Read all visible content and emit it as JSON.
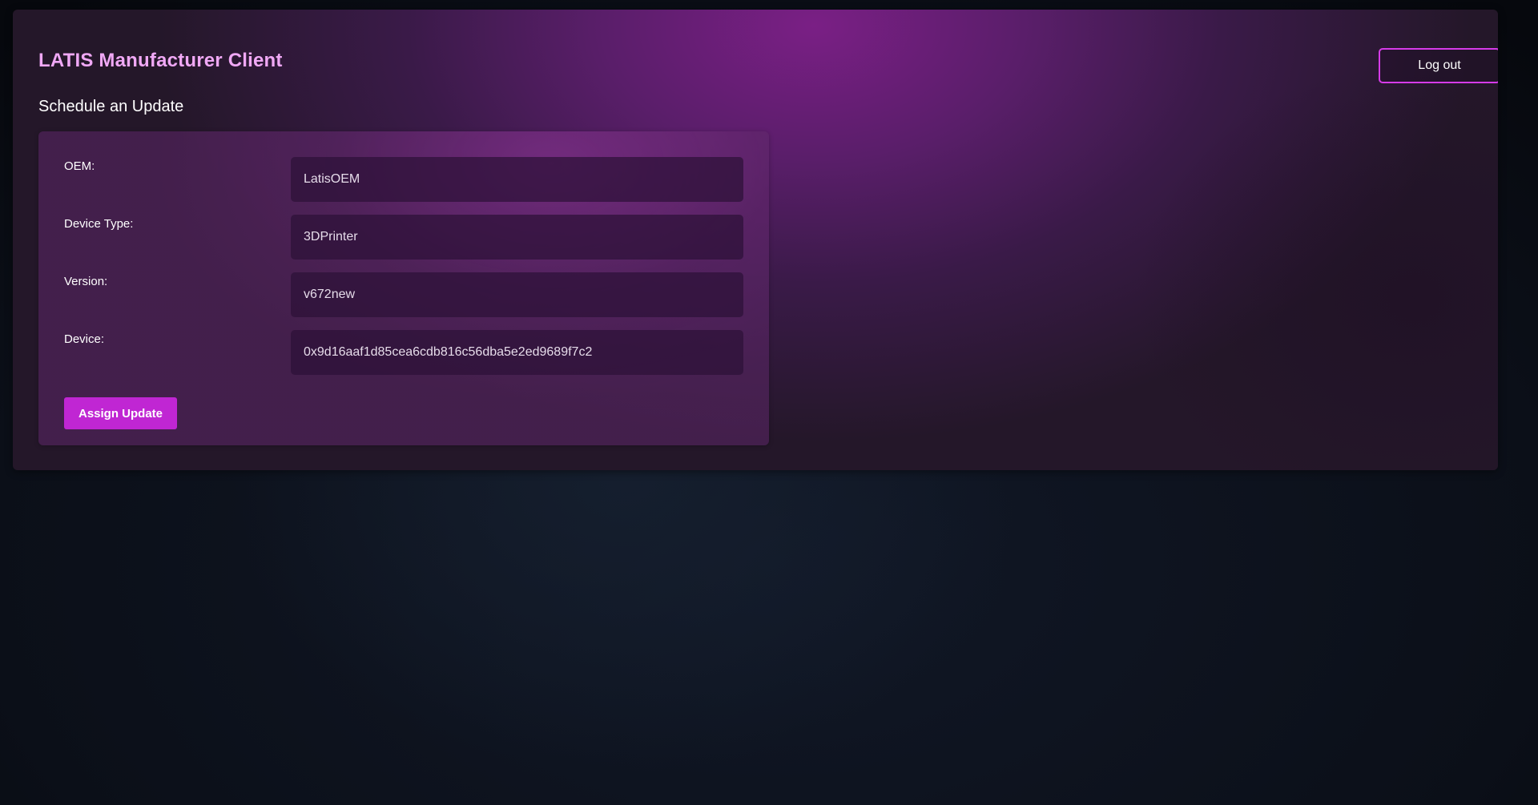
{
  "header": {
    "app_title": "LATIS Manufacturer Client",
    "logout_label": "Log out"
  },
  "page": {
    "section_title": "Schedule an Update"
  },
  "form": {
    "fields": [
      {
        "label": "OEM:",
        "value": "LatisOEM"
      },
      {
        "label": "Device Type:",
        "value": "3DPrinter"
      },
      {
        "label": "Version:",
        "value": "v672new"
      },
      {
        "label": "Device:",
        "value": "0x9d16aaf1d85cea6cdb816c56dba5e2ed9689f7c2"
      }
    ],
    "submit_label": "Assign Update"
  },
  "colors": {
    "title_accent": "#f0a8f5",
    "button_primary": "#c026d3",
    "logout_border": "#d63be8",
    "background": "#0b0f18"
  }
}
